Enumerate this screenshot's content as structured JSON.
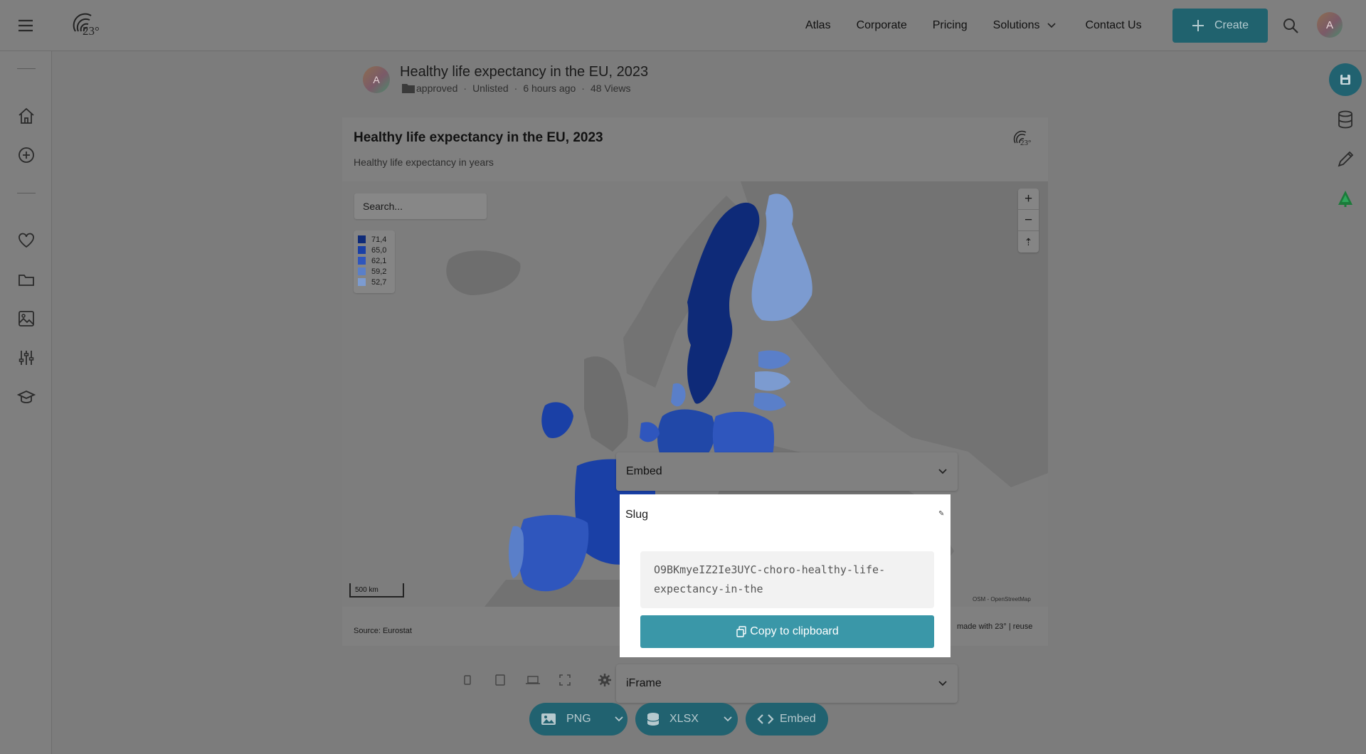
{
  "nav": {
    "links": [
      "Atlas",
      "Corporate",
      "Pricing",
      "Solutions",
      "Contact Us"
    ],
    "create_label": "Create",
    "avatar_initial": "A",
    "logo_text": "23°"
  },
  "sidebar": {
    "icons": [
      "home-icon",
      "add-circle-icon",
      "heart-icon",
      "folder-icon",
      "image-icon",
      "sliders-icon",
      "graduation-icon"
    ]
  },
  "rail": {
    "icons": [
      "save-icon",
      "database-icon",
      "pencil-icon",
      "tree-icon"
    ]
  },
  "header": {
    "title": "Healthy life expectancy in the EU, 2023",
    "folder": "approved",
    "visibility": "Unlisted",
    "time": "6 hours ago",
    "views": "48 Views",
    "avatar_initial": "A"
  },
  "card": {
    "title": "Healthy life expectancy in the EU, 2023",
    "subtitle": "Healthy life expectancy in years",
    "search_placeholder": "Search...",
    "source": "Source: Eurostat",
    "madewith": "made with 23° | reuse",
    "attribution": "OSM - OpenStreetMap",
    "scale": "500 km",
    "logo_text": "23°",
    "legend": [
      {
        "label": "71,4",
        "color": "#0e2a78"
      },
      {
        "label": "65,0",
        "color": "#1a40a6"
      },
      {
        "label": "62,1",
        "color": "#2f56bd"
      },
      {
        "label": "59,2",
        "color": "#5a7fc9"
      },
      {
        "label": "52,7",
        "color": "#7c9bd0"
      }
    ]
  },
  "embed": {
    "dropdown_label": "Embed",
    "slug_label": "Slug",
    "slug_line1": "O9BKmyeIZ2Ie3UYC-choro-healthy-life-",
    "slug_line2": "expectancy-in-the",
    "copy_label": "Copy to clipboard",
    "iframe_label": "iFrame"
  },
  "bottom": {
    "png": "PNG",
    "xlsx": "XLSX",
    "embed": "Embed"
  },
  "colors": {
    "accent": "#20626e",
    "copy_button": "#3a97a8",
    "sweden": "#0e2a78",
    "finland": "#7c9bd0",
    "germany": "#2148a8",
    "spain": "#2f56bd"
  }
}
